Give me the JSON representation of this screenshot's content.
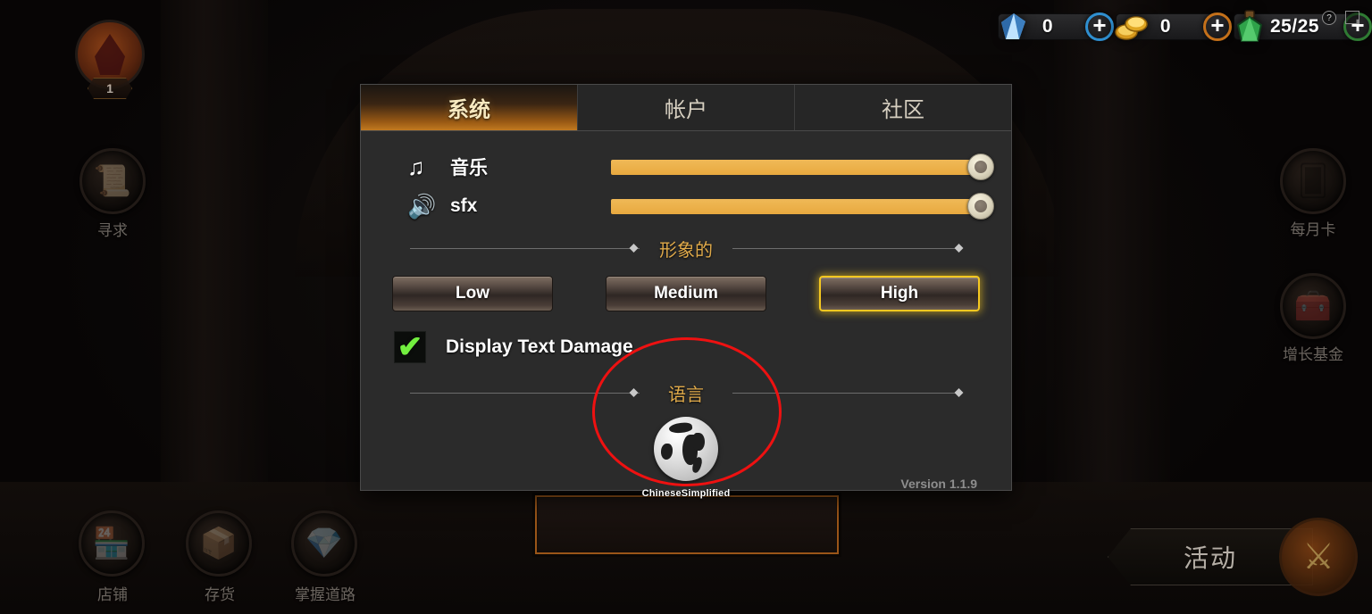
{
  "hud": {
    "currencies": [
      {
        "icon": "gem-icon",
        "name": "gems",
        "value": "0",
        "plus_label": "+",
        "accent": "#2f8fd0"
      },
      {
        "icon": "coin-icon",
        "name": "gold",
        "value": "0",
        "plus_label": "+",
        "accent": "#c4701a"
      },
      {
        "icon": "energy-potion-icon",
        "name": "energy",
        "value": "25/25",
        "plus_label": "+",
        "accent": "#2f7a33"
      }
    ],
    "help_label": "?",
    "mail_label": ""
  },
  "player": {
    "level": "1"
  },
  "left_nav": [
    {
      "icon": "quest-scroll-icon",
      "label": "寻求"
    }
  ],
  "right_nav": [
    {
      "icon": "monthly-card-icon",
      "label": "每月卡"
    },
    {
      "icon": "growth-fund-chest-icon",
      "label": "增长基金"
    }
  ],
  "bottom_nav": [
    {
      "icon": "shop-stall-icon",
      "label": "店铺"
    },
    {
      "icon": "inventory-box-icon",
      "label": "存货"
    },
    {
      "icon": "mastery-crystals-icon",
      "label": "掌握道路"
    }
  ],
  "activity": {
    "label": "活动",
    "emblem_icon": "crossed-swords-icon"
  },
  "dialog": {
    "tabs": [
      {
        "label": "系统",
        "active": true
      },
      {
        "label": "帐户",
        "active": false
      },
      {
        "label": "社区",
        "active": false
      }
    ],
    "sliders": [
      {
        "icon": "music-note-icon",
        "label": "音乐",
        "value": 100
      },
      {
        "icon": "speaker-icon",
        "label": "sfx",
        "value": 100
      }
    ],
    "graphics_section": {
      "title": "形象的",
      "options": [
        {
          "label": "Low",
          "selected": false
        },
        {
          "label": "Medium",
          "selected": false
        },
        {
          "label": "High",
          "selected": true
        }
      ]
    },
    "checkbox": {
      "label": "Display Text Damage",
      "checked": true,
      "tick_glyph": "✔"
    },
    "language_section": {
      "title": "语言",
      "icon": "globe-icon",
      "current": "ChineseSimplified"
    },
    "version": "Version 1.1.9"
  },
  "colors": {
    "accent_amber": "#e8a93f",
    "tab_active_orange": "#c27a20",
    "selected_border": "#f5c820",
    "check_green": "#72ee3f",
    "annotation_red": "#ee1111",
    "dialog_bg": "#2b2b2b"
  }
}
